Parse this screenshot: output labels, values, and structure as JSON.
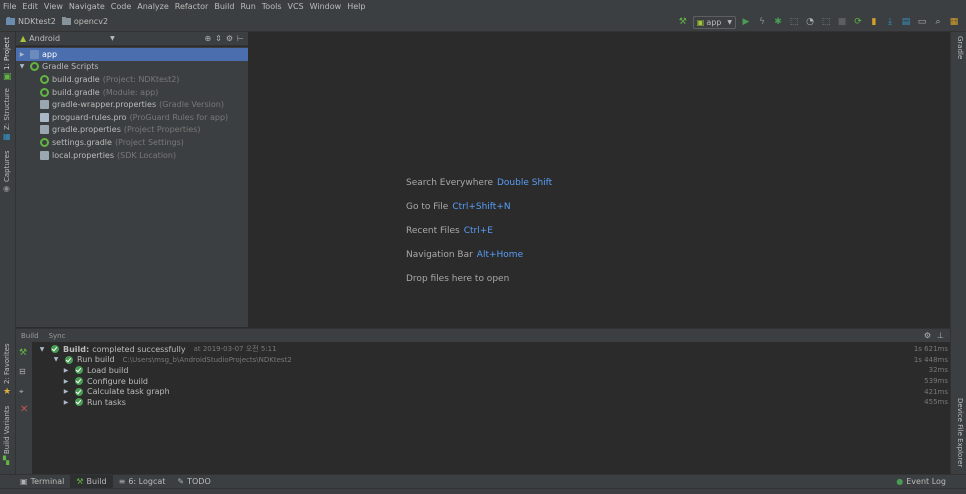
{
  "menu": [
    "File",
    "Edit",
    "View",
    "Navigate",
    "Code",
    "Analyze",
    "Refactor",
    "Build",
    "Run",
    "Tools",
    "VCS",
    "Window",
    "Help"
  ],
  "breadcrumb": {
    "project": "NDKtest2",
    "folder": "opencv2"
  },
  "toolbar": {
    "run_config": "app"
  },
  "left_tabs": {
    "project": "1: Project",
    "structure": "Z: Structure",
    "captures": "Captures",
    "favorites": "2: Favorites",
    "build_variants": "Build Variants"
  },
  "right_tabs": {
    "gradle": "Gradle",
    "device_explorer": "Device File Explorer"
  },
  "project_panel": {
    "view": "Android"
  },
  "tree": [
    {
      "label": "app",
      "hint": "",
      "kind": "folder",
      "depth": 0,
      "expanded": false,
      "selected": true
    },
    {
      "label": "Gradle Scripts",
      "hint": "",
      "kind": "gradle",
      "depth": 0,
      "expanded": true,
      "selected": false
    },
    {
      "label": "build.gradle",
      "hint": "(Project: NDKtest2)",
      "kind": "gradle",
      "depth": 1
    },
    {
      "label": "build.gradle",
      "hint": "(Module: app)",
      "kind": "gradle",
      "depth": 1
    },
    {
      "label": "gradle-wrapper.properties",
      "hint": "(Gradle Version)",
      "kind": "props",
      "depth": 1
    },
    {
      "label": "proguard-rules.pro",
      "hint": "(ProGuard Rules for app)",
      "kind": "file",
      "depth": 1
    },
    {
      "label": "gradle.properties",
      "hint": "(Project Properties)",
      "kind": "props",
      "depth": 1
    },
    {
      "label": "settings.gradle",
      "hint": "(Project Settings)",
      "kind": "gradle",
      "depth": 1
    },
    {
      "label": "local.properties",
      "hint": "(SDK Location)",
      "kind": "props",
      "depth": 1
    }
  ],
  "editor_hints": [
    {
      "label": "Search Everywhere",
      "key": "Double Shift"
    },
    {
      "label": "Go to File",
      "key": "Ctrl+Shift+N"
    },
    {
      "label": "Recent Files",
      "key": "Ctrl+E"
    },
    {
      "label": "Navigation Bar",
      "key": "Alt+Home"
    },
    {
      "label": "Drop files here to open",
      "key": ""
    }
  ],
  "build_panel": {
    "tabs": [
      "Build",
      "Sync"
    ],
    "rows": [
      {
        "text": "Build:",
        "text2": "completed successfully",
        "detail": "at 2019-03-07 오전 5:11",
        "time": "1s 621ms",
        "depth": 0
      },
      {
        "text": "Run build",
        "text2": "",
        "detail": "C:\\Users\\msg_b\\AndroidStudioProjects\\NDKtest2",
        "time": "1s 448ms",
        "depth": 1
      },
      {
        "text": "Load build",
        "text2": "",
        "detail": "",
        "time": "32ms",
        "depth": 2
      },
      {
        "text": "Configure build",
        "text2": "",
        "detail": "",
        "time": "539ms",
        "depth": 2
      },
      {
        "text": "Calculate task graph",
        "text2": "",
        "detail": "",
        "time": "421ms",
        "depth": 2
      },
      {
        "text": "Run tasks",
        "text2": "",
        "detail": "",
        "time": "455ms",
        "depth": 2
      }
    ]
  },
  "bottom_tabs": [
    {
      "label": "Terminal",
      "icon": "terminal-icon",
      "selected": false
    },
    {
      "label": "Build",
      "icon": "build-icon",
      "selected": true
    },
    {
      "label": "6: Logcat",
      "icon": "logcat-icon",
      "selected": false
    },
    {
      "label": "TODO",
      "icon": "todo-icon",
      "selected": false
    }
  ],
  "event_log": "Event Log",
  "colors": {
    "accent": "#4b6eaf",
    "link": "#589df6",
    "ok": "#499c54",
    "gradle": "#62b543"
  }
}
